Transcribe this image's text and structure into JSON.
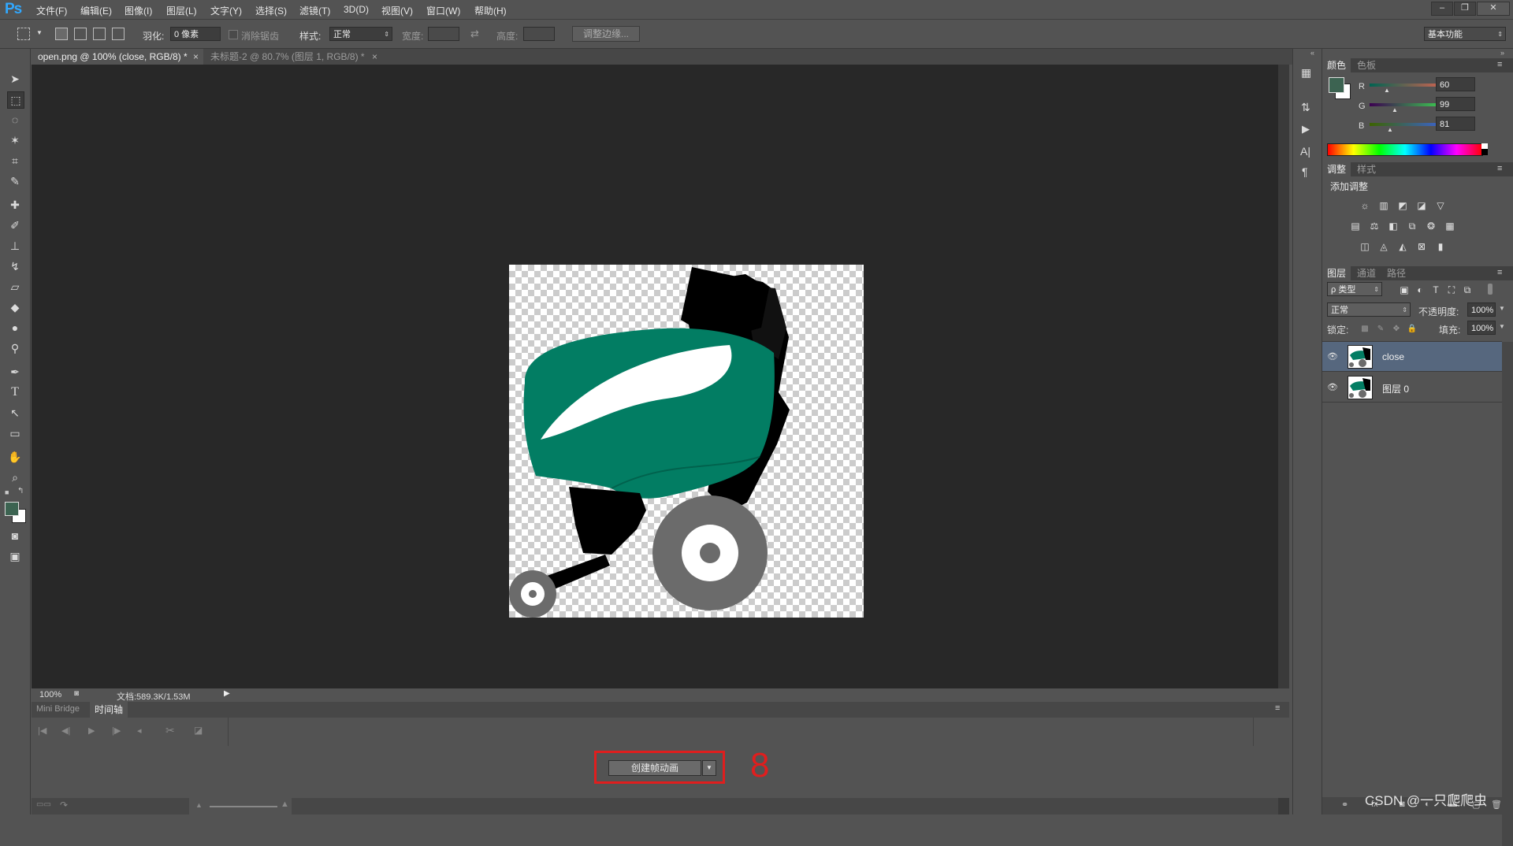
{
  "app": {
    "logo": "Ps"
  },
  "menu": [
    "文件(F)",
    "编辑(E)",
    "图像(I)",
    "图层(L)",
    "文字(Y)",
    "选择(S)",
    "滤镜(T)",
    "3D(D)",
    "视图(V)",
    "窗口(W)",
    "帮助(H)"
  ],
  "options": {
    "feather_label": "羽化:",
    "feather_value": "0 像素",
    "antialias_label": "消除锯齿",
    "style_label": "样式:",
    "style_value": "正常",
    "width_label": "宽度:",
    "height_label": "高度:",
    "refine_edge": "调整边缘...",
    "workspace": "基本功能"
  },
  "tabs": [
    {
      "label": "open.png @ 100% (close, RGB/8) *",
      "active": true
    },
    {
      "label": "未标题-2 @ 80.7% (图层 1, RGB/8) *",
      "active": false
    }
  ],
  "status": {
    "zoom": "100%",
    "doc": "文档:589.3K/1.53M"
  },
  "timeline": {
    "tabs": [
      "Mini Bridge",
      "时间轴"
    ],
    "create_button": "创建帧动画",
    "annotation": "8"
  },
  "color_panel": {
    "tabs": [
      "颜色",
      "色板"
    ],
    "r_label": "R",
    "r": "60",
    "g_label": "G",
    "g": "99",
    "b_label": "B",
    "b": "81",
    "fg_color": "#3c6351"
  },
  "adjust_panel": {
    "tabs": [
      "调整",
      "样式"
    ],
    "title": "添加调整"
  },
  "layers_panel": {
    "tabs": [
      "图层",
      "通道",
      "路径"
    ],
    "filter_kind": "ρ 类型",
    "blend_mode": "正常",
    "opacity_label": "不透明度:",
    "opacity": "100%",
    "lock_label": "锁定:",
    "fill_label": "填充:",
    "fill": "100%",
    "layers": [
      {
        "name": "close",
        "selected": true
      },
      {
        "name": "图层 0",
        "selected": false
      }
    ]
  },
  "watermark": "CSDN @一只爬爬虫"
}
